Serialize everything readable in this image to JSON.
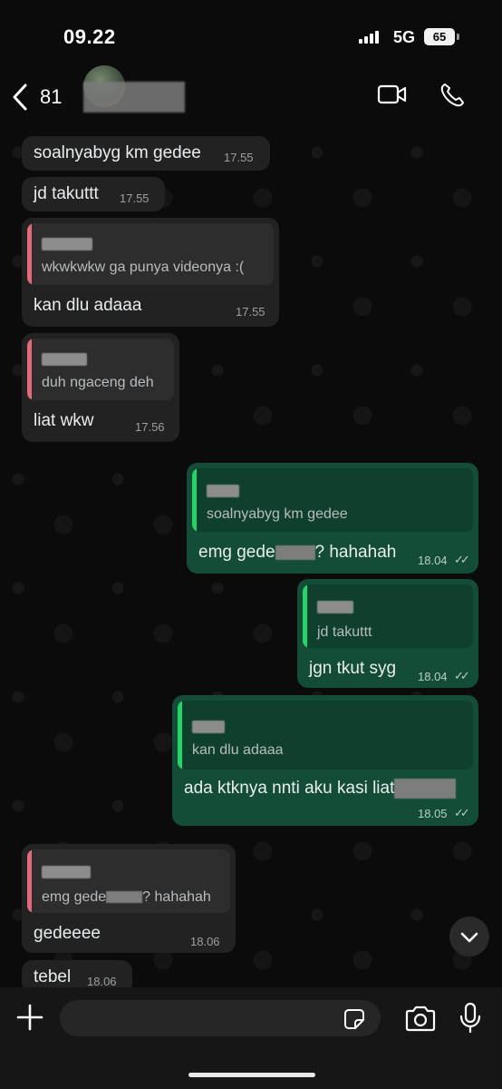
{
  "status_bar": {
    "time": "09.22",
    "network": "5G",
    "battery": "65",
    "icons": [
      "signal-icon"
    ]
  },
  "header": {
    "back_count": "81",
    "icons": [
      "chevron-left-icon",
      "video-icon",
      "phone-icon"
    ]
  },
  "messages": [
    {
      "dir": "in",
      "text": "soalnyabyg km gedee",
      "time": "17.55"
    },
    {
      "dir": "in",
      "text": "jd takuttt",
      "time": "17.55"
    },
    {
      "dir": "in",
      "quote": "wkwkwkw ga punya videonya :(",
      "text": "kan dlu adaaa",
      "time": "17.55"
    },
    {
      "dir": "in",
      "quote": "duh ngaceng deh",
      "text": "liat wkw",
      "time": "17.56"
    },
    {
      "dir": "out",
      "quote": "soalnyabyg km gedee",
      "text_before": "emg gede",
      "text_after": "? hahahah",
      "time": "18.04"
    },
    {
      "dir": "out",
      "quote": "jd takuttt",
      "text": "jgn tkut syg",
      "time": "18.04"
    },
    {
      "dir": "out",
      "quote": "kan dlu adaaa",
      "text": "ada ktknya nnti aku kasi liat",
      "time": "18.05"
    },
    {
      "dir": "in",
      "quote_before": "emg gede",
      "quote_after": "? hahahah",
      "text": "gedeeee",
      "time": "18.06"
    },
    {
      "dir": "in",
      "text": "tebel",
      "time": "18.06"
    }
  ],
  "composer": {
    "placeholder": "",
    "icons": [
      "plus-icon",
      "sticker-icon",
      "camera-icon",
      "microphone-icon"
    ]
  },
  "colors": {
    "incoming": "#222222",
    "outgoing": "#134d37",
    "quote_in_bar": "#e26a7a",
    "quote_out_bar": "#25d366"
  }
}
